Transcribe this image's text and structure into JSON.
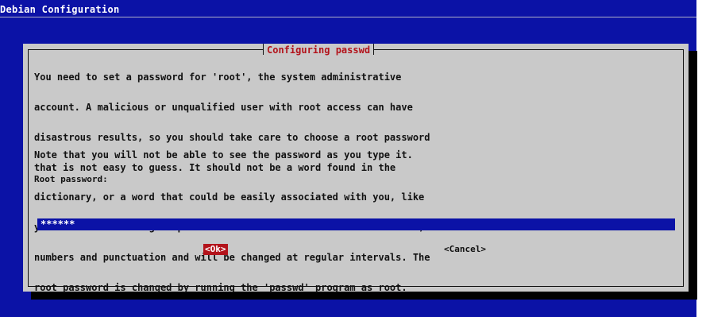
{
  "screen": {
    "title": "Debian Configuration",
    "background_color": "#0b12a6"
  },
  "dialog": {
    "title": "Configuring passwd",
    "body_lines": [
      "You need to set a password for 'root', the system administrative",
      "account. A malicious or unqualified user with root access can have",
      "disastrous results, so you should take care to choose a root password",
      "that is not easy to guess. It should not be a word found in the",
      "dictionary, or a word that could be easily associated with you, like",
      "your middle name. A good password will contain a mixture of letters,",
      "numbers and punctuation and will be changed at regular intervals. The",
      "root password is changed by running the 'passwd' program as root."
    ],
    "note": "Note that you will not be able to see the password as you type it.",
    "field_label": "Root password:",
    "password_value": "******",
    "ok_label": "<Ok>",
    "cancel_label": "<Cancel>",
    "title_color": "#b3131b",
    "dialog_color": "#c9c9c9"
  }
}
